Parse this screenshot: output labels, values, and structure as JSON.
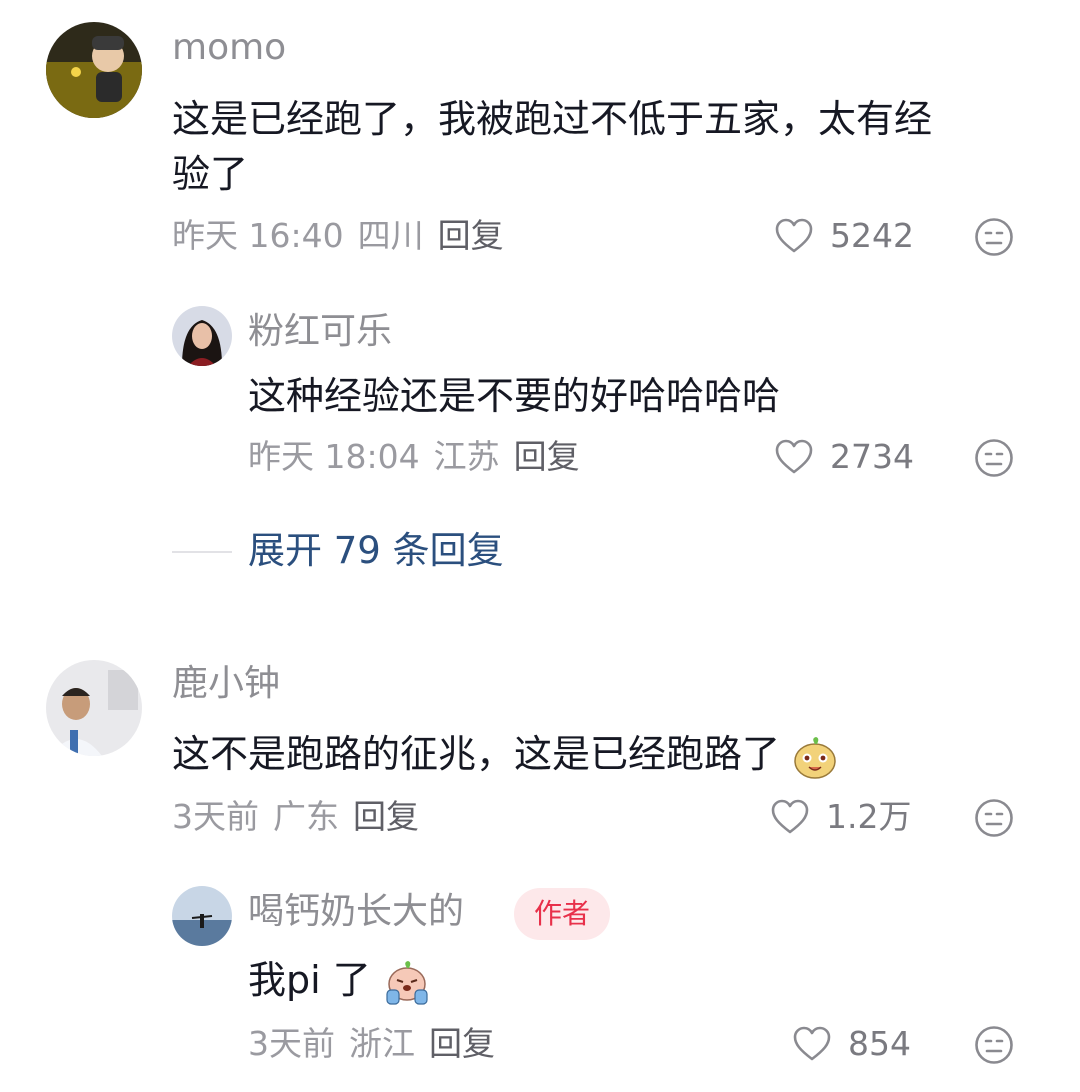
{
  "comments": [
    {
      "username": "momo",
      "text_line1": "这是已经跑了，我被跑过不低于五家，太有经",
      "text_line2": "验了",
      "time": "昨天 16:40",
      "location": "四川",
      "reply_label": "回复",
      "likes": "5242"
    },
    {
      "username": "粉红可乐",
      "text": "这种经验还是不要的好哈哈哈哈",
      "time": "昨天 18:04",
      "location": "江苏",
      "reply_label": "回复",
      "likes": "2734"
    },
    {
      "username": "鹿小钟",
      "text": "这不是跑路的征兆，这是已经跑路了",
      "time": "3天前",
      "location": "广东",
      "reply_label": "回复",
      "likes": "1.2万"
    },
    {
      "username": "喝钙奶长大的",
      "badge": "作者",
      "text": "我pi 了",
      "time": "3天前",
      "location": "浙江",
      "reply_label": "回复",
      "likes": "854"
    }
  ],
  "expand_replies": "展开 79 条回复",
  "colors": {
    "link": "#2b4f7e",
    "badge_text": "#e8304a",
    "badge_bg": "#fde8ea"
  },
  "icons": [
    "heart-icon",
    "dislike-face-icon",
    "smile-emoji-icon",
    "crying-emoji-icon"
  ]
}
